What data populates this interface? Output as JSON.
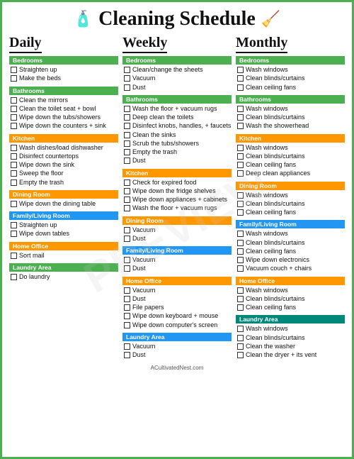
{
  "header": {
    "title": "Cleaning Schedule",
    "watermark": "PREVIEW"
  },
  "footer": {
    "text": "ACultivatedNest.com"
  },
  "columns": {
    "daily": {
      "heading": "Daily",
      "sections": [
        {
          "label": "Bedrooms",
          "color": "green",
          "items": [
            "Straighten up",
            "Make the beds"
          ]
        },
        {
          "label": "Bathrooms",
          "color": "green",
          "items": [
            "Clean the mirrors",
            "Clean the toilet seat + bowl",
            "Wipe down the tubs/showers",
            "Wipe down the counters + sink"
          ]
        },
        {
          "label": "Kitchen",
          "color": "orange",
          "items": [
            "Wash dishes/load dishwasher",
            "Disinfect countertops",
            "Wipe down the sink",
            "Sweep the floor",
            "Empty the trash"
          ]
        },
        {
          "label": "Dining Room",
          "color": "orange",
          "items": [
            "Wipe down the dining table"
          ]
        },
        {
          "label": "Family/Living Room",
          "color": "blue",
          "items": [
            "Straighten up",
            "Wipe down tables"
          ]
        },
        {
          "label": "Home Office",
          "color": "orange",
          "items": [
            "Sort mail"
          ]
        },
        {
          "label": "Laundry Area",
          "color": "green",
          "items": [
            "Do laundry"
          ]
        }
      ]
    },
    "weekly": {
      "heading": "Weekly",
      "sections": [
        {
          "label": "Bedrooms",
          "color": "green",
          "items": [
            "Clean/change the sheets",
            "Vacuum",
            "Dust"
          ]
        },
        {
          "label": "Bathrooms",
          "color": "green",
          "items": [
            "Wash the floor + vacuum rugs",
            "Deep clean the toilets",
            "Disinfect knobs, handles, + faucets",
            "Clean the sinks",
            "Scrub the tubs/showers",
            "Empty the trash",
            "Dust"
          ]
        },
        {
          "label": "Kitchen",
          "color": "orange",
          "items": [
            "Check for expired food",
            "Wipe down the fridge shelves",
            "Wipe down appliances + cabinets",
            "Wash the floor + vacuum rugs"
          ]
        },
        {
          "label": "Dining Room",
          "color": "orange",
          "items": [
            "Vacuum",
            "Dust"
          ]
        },
        {
          "label": "Family/Living Room",
          "color": "blue",
          "items": [
            "Vacuum",
            "Dust"
          ]
        },
        {
          "label": "Home Office",
          "color": "orange",
          "items": [
            "Vacuum",
            "Dust",
            "File papers",
            "Wipe down keyboard + mouse",
            "Wipe down computer's screen"
          ]
        },
        {
          "label": "Laundry Area",
          "color": "blue",
          "items": [
            "Vacuum",
            "Dust"
          ]
        }
      ]
    },
    "monthly": {
      "heading": "Monthly",
      "sections": [
        {
          "label": "Bedrooms",
          "color": "green",
          "items": [
            "Wash windows",
            "Clean blinds/curtains",
            "Clean ceiling fans"
          ]
        },
        {
          "label": "Bathrooms",
          "color": "green",
          "items": [
            "Wash windows",
            "Clean blinds/curtains",
            "Wash the showerhead"
          ]
        },
        {
          "label": "Kitchen",
          "color": "orange",
          "items": [
            "Wash windows",
            "Clean blinds/curtains",
            "Clean ceiling fans",
            "Deep clean appliances"
          ]
        },
        {
          "label": "Dining Room",
          "color": "orange",
          "items": [
            "Wash windows",
            "Clean blinds/curtains",
            "Clean ceiling fans"
          ]
        },
        {
          "label": "Family/Living Room",
          "color": "blue",
          "items": [
            "Wash windows",
            "Clean blinds/curtains",
            "Clean ceiling fans",
            "Wipe down electronics",
            "Vacuum couch + chairs"
          ]
        },
        {
          "label": "Home Office",
          "color": "orange",
          "items": [
            "Wash windows",
            "Clean blinds/curtains",
            "Clean ceiling fans"
          ]
        },
        {
          "label": "Laundry Area",
          "color": "teal",
          "items": [
            "Wash windows",
            "Clean blinds/curtains",
            "Clean the washer",
            "Clean the dryer + its vent"
          ]
        }
      ]
    }
  }
}
